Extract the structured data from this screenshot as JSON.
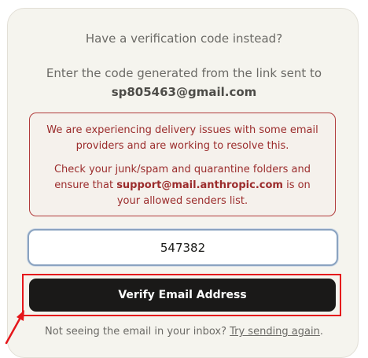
{
  "verification": {
    "heading": "Have a verification code instead?",
    "subtext": "Enter the code generated from the link sent to",
    "email": "sp805463@gmail.com"
  },
  "alert": {
    "line1": "We are experiencing delivery issues with some email providers and are working to resolve this.",
    "line2_before": "Check your junk/spam and quarantine folders and ensure that ",
    "line2_email": "support@mail.anthropic.com",
    "line2_after": " is on your allowed senders list."
  },
  "code_input": {
    "value": "547382"
  },
  "verify_button": {
    "label": "Verify Email Address"
  },
  "resend": {
    "prompt": "Not seeing the email in your inbox? ",
    "link_label": "Try sending again",
    "suffix": "."
  },
  "colors": {
    "annotation": "#e5161b",
    "alert_text": "#9b2c2c",
    "button_bg": "#1a1918"
  },
  "icons": {
    "annotation_arrow": "arrow-pointer-icon"
  }
}
